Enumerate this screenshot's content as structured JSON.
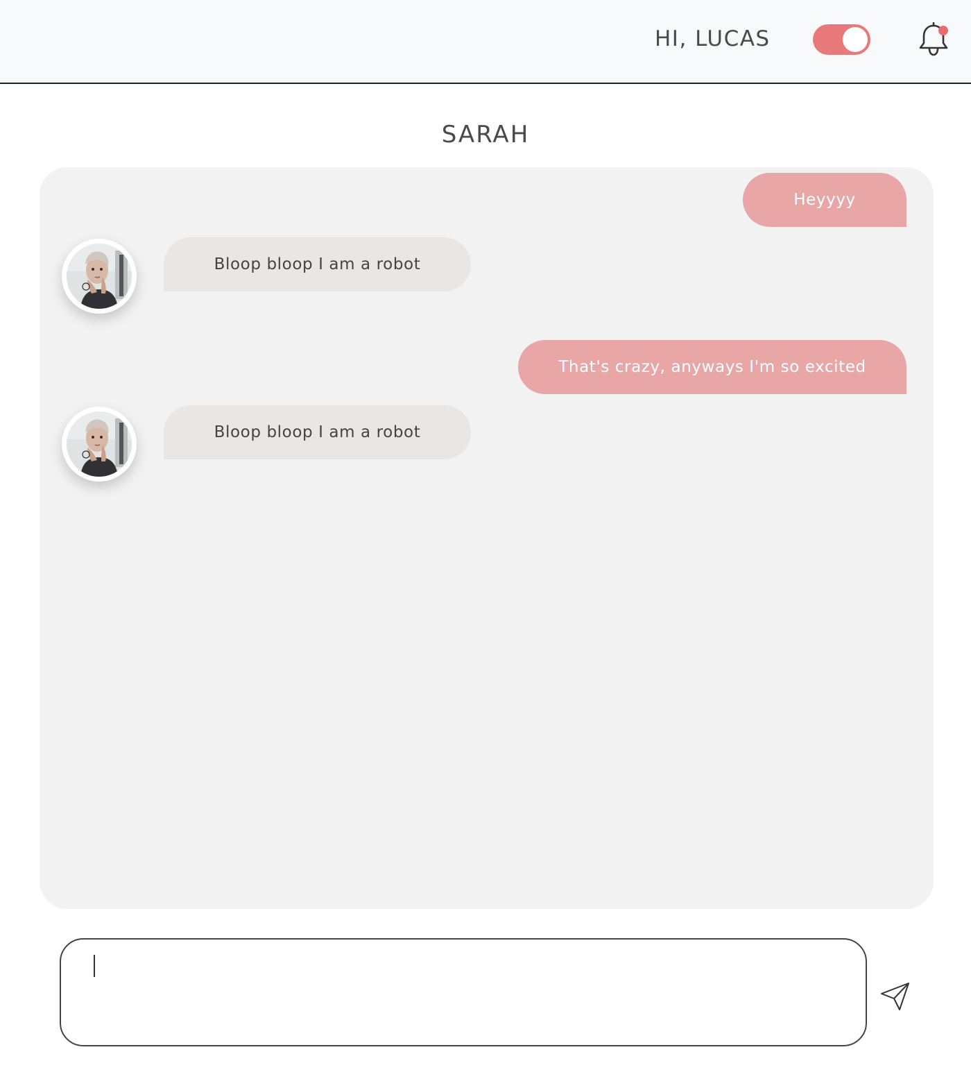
{
  "header": {
    "greeting": "HI, LUCAS",
    "toggle": {
      "state": "on",
      "color": "#e8797a"
    },
    "notification": {
      "icon": "bell-icon",
      "has_unread": true,
      "dot_color": "#ec6b6f"
    }
  },
  "conversation": {
    "contact_name": "SARAH",
    "messages": [
      {
        "sender": "me",
        "text": "Heyyyy"
      },
      {
        "sender": "contact",
        "text": "Bloop bloop I am a robot",
        "avatar": "contact-avatar"
      },
      {
        "sender": "me",
        "text": "That's crazy, anyways I'm so excited"
      },
      {
        "sender": "contact",
        "text": "Bloop bloop I am a robot",
        "avatar": "contact-avatar"
      }
    ]
  },
  "composer": {
    "value": "",
    "placeholder": "",
    "send_icon": "send-icon"
  },
  "colors": {
    "sent_bubble": "#e9a6a6",
    "received_bubble": "#e8e7e6",
    "panel": "#f2f2f2",
    "header": "#f8f9fb"
  }
}
